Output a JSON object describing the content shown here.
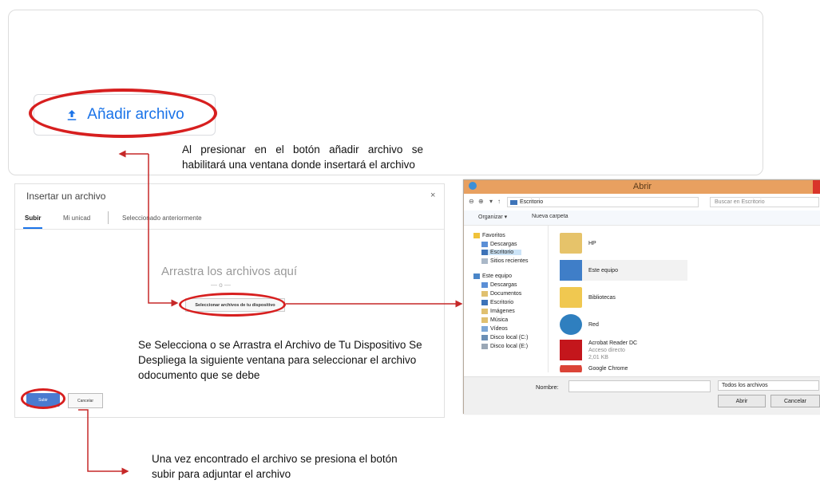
{
  "add_file_button": {
    "label": "Añadir archivo"
  },
  "notes": {
    "add_file_note": "Al presionar en el botón añadir archivo se habilitará una ventana donde insertará el archivo",
    "select_note": "Se Selecciona o se Arrastra el Archivo de Tu Dispositivo Se Despliega la siguiente ventana para seleccionar el archivo odocumento que se debe",
    "upload_note": "Una vez encontrado el archivo se presiona el botón subir para adjuntar el archivo"
  },
  "insert_dialog": {
    "title": "Insertar un archivo",
    "close": "×",
    "tabs": [
      "Subir",
      "Mi unicad",
      "Seleccionado anteriormente"
    ],
    "drag_text": "Arrastra los archivos aquí",
    "or_text": "— o —",
    "select_button": "Seleccionar archivos de tu dispositivo",
    "upload_button": "Subir",
    "cancel_button": "Cancelar"
  },
  "open_dialog": {
    "title": "Abrir",
    "address": "Escritorio",
    "search_placeholder": "Buscar en Escritorio",
    "toolbar": {
      "organize": "Organizar ▾",
      "new_folder": "Nueva carpeta"
    },
    "sidebar": {
      "favorites": "Favoritos",
      "fav_items": [
        "Descargas",
        "Escritorio",
        "Sitios recientes"
      ],
      "this_pc": "Este equipo",
      "pc_items": [
        "Descargas",
        "Documentos",
        "Escritorio",
        "Imágenes",
        "Música",
        "Vídeos",
        "Disco local (C:)",
        "Disco local (E:)"
      ]
    },
    "files": [
      {
        "name": "HP",
        "icon": "user-folder-icon"
      },
      {
        "name": "Este equipo",
        "icon": "computer-icon"
      },
      {
        "name": "Bibliotecas",
        "icon": "folder-icon"
      },
      {
        "name": "Red",
        "icon": "network-icon"
      },
      {
        "name": "Acrobat Reader DC",
        "sub1": "Acceso directo",
        "sub2": "2,01 KB",
        "icon": "pdf-icon"
      },
      {
        "name": "Google Chrome",
        "icon": "chrome-icon"
      }
    ],
    "name_label": "Nombre:",
    "filter": "Todos los archivos",
    "open_button": "Abrir",
    "cancel_button": "Cancelar"
  },
  "colors": {
    "accent_blue": "#1a73e8",
    "highlight_red": "#d71f1f",
    "arrow_red": "#c62828"
  }
}
